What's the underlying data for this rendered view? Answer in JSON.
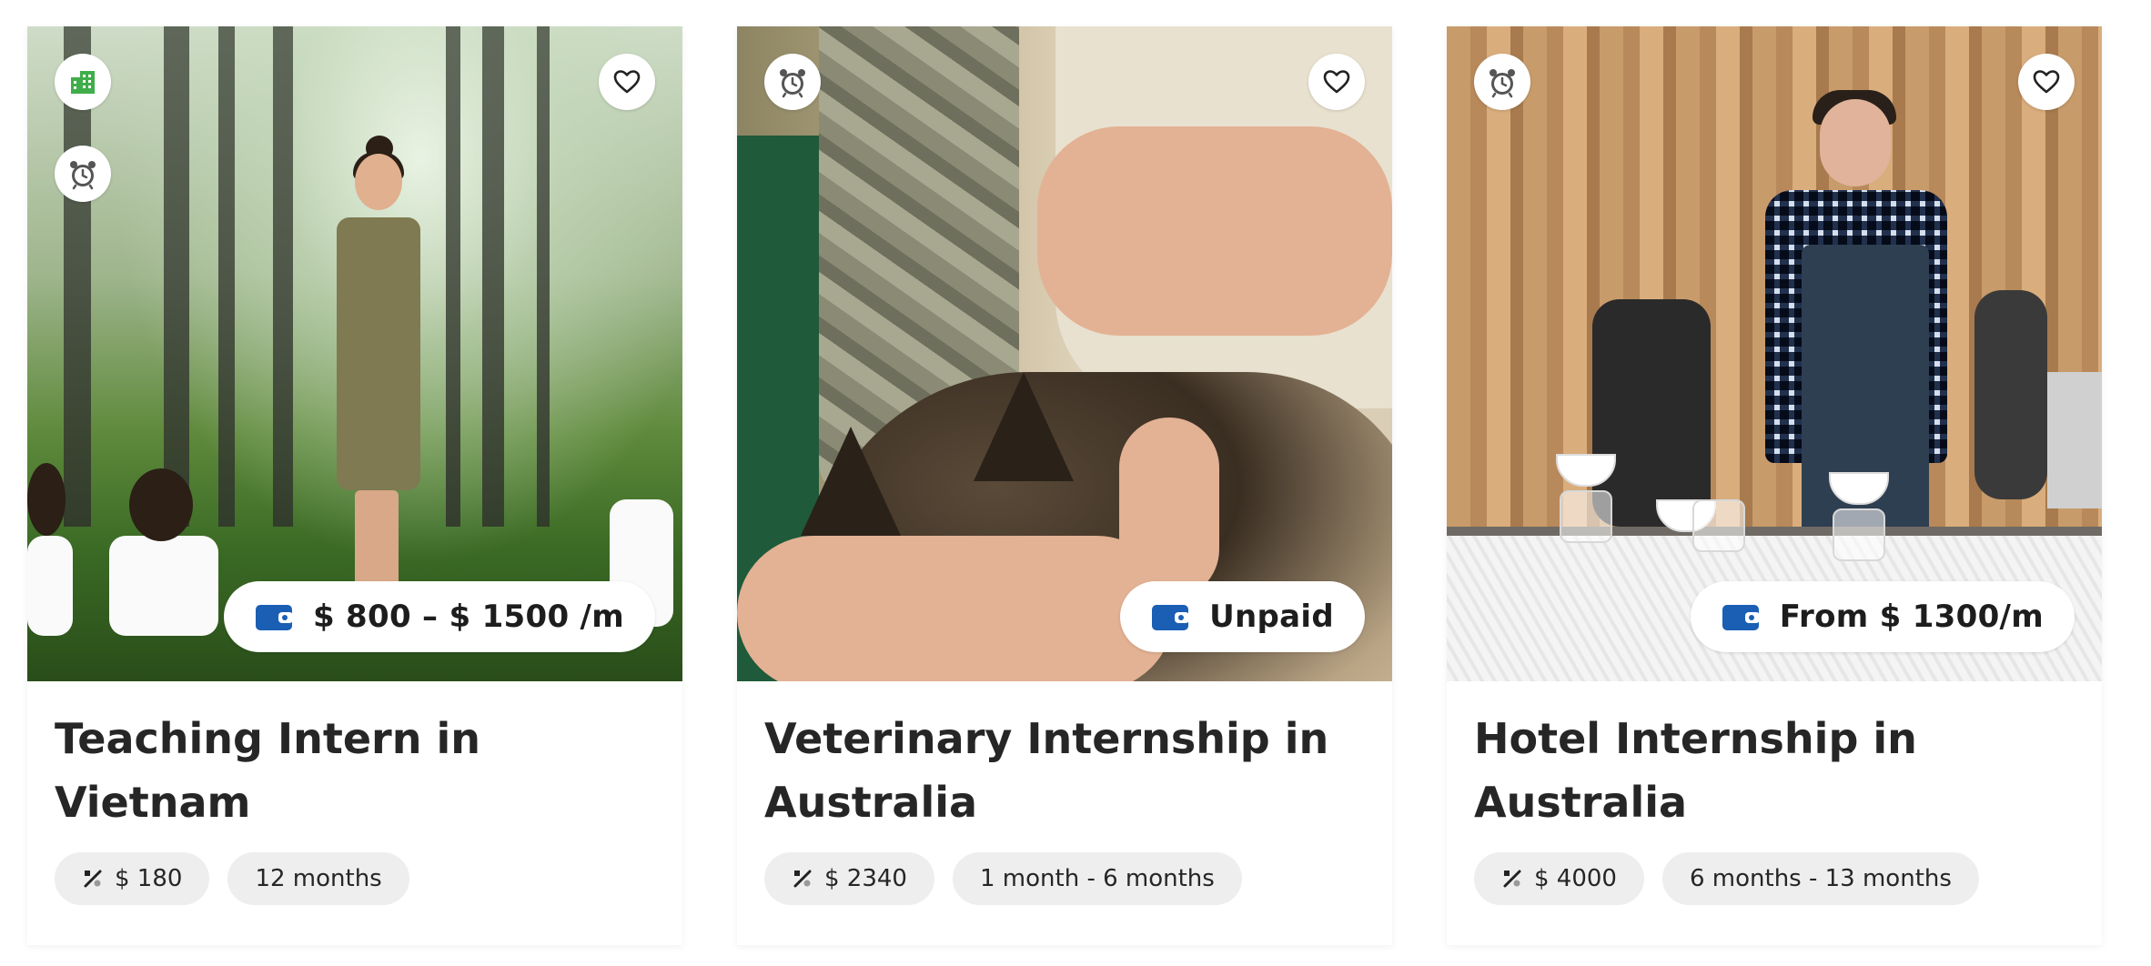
{
  "cards": [
    {
      "title": "Teaching Intern in Vietnam",
      "pay": "$ 800 – $ 1500 /m",
      "fee": "$ 180",
      "duration": "12 months",
      "top_icons": [
        "company-icon",
        "alarm-clock-icon"
      ],
      "favorite_icon": "heart-outline-icon",
      "pay_icon": "wallet-icon",
      "fee_icon": "discount-icon"
    },
    {
      "title": "Veterinary Internship in Australia",
      "pay": "Unpaid",
      "fee": "$ 2340",
      "duration": "1 month - 6 months",
      "top_icons": [
        "alarm-clock-icon"
      ],
      "favorite_icon": "heart-outline-icon",
      "pay_icon": "wallet-icon",
      "fee_icon": "discount-icon"
    },
    {
      "title": "Hotel Internship in Australia",
      "pay": "From $ 1300/m",
      "fee": "$ 4000",
      "duration": "6 months - 13 months",
      "top_icons": [
        "alarm-clock-icon"
      ],
      "favorite_icon": "heart-outline-icon",
      "pay_icon": "wallet-icon",
      "fee_icon": "discount-icon"
    }
  ],
  "colors": {
    "wallet": "#1a5fb4",
    "company": "#3fae4a",
    "title_text": "#262626",
    "chip_bg": "#eeeeee",
    "clock": "#555555"
  }
}
